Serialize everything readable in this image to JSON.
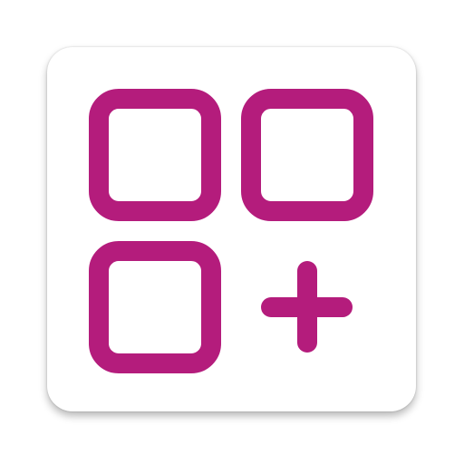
{
  "icon": {
    "name": "add-widget-app-icon",
    "glyph": "grid-plus-icon",
    "colors": {
      "accent": "#B41C7C",
      "background": "#FFFFFF"
    }
  }
}
